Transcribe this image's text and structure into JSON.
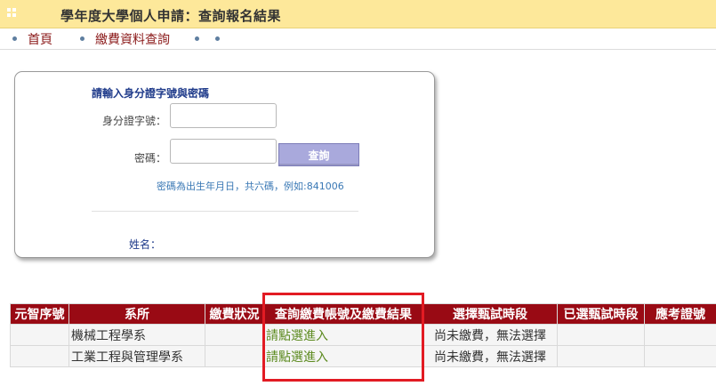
{
  "title": "學年度大學個人申請：查詢報名結果",
  "nav": {
    "home": "首頁",
    "fee_query": "繳費資料查詢"
  },
  "login": {
    "heading": "請輸入身分證字號與密碼",
    "id_label": "身分證字號：",
    "id_value": "",
    "password_label": "密碼：",
    "password_value": "",
    "query_button": "查詢",
    "hint": "密碼為出生年月日，共六碼，例如:841006",
    "name_label": "姓名："
  },
  "table": {
    "headers": [
      "元智序號",
      "系所",
      "繳費狀況",
      "查詢繳費帳號及繳費結果",
      "選擇甄試時段",
      "已選甄試時段",
      "應考證號"
    ],
    "rows": [
      [
        "",
        "機械工程學系",
        "",
        "請點選進入",
        "尚未繳費，無法選擇",
        "",
        ""
      ],
      [
        "",
        "工業工程與管理學系",
        "",
        "請點選進入",
        "尚未繳費，無法選擇",
        "",
        ""
      ]
    ]
  },
  "colors": {
    "title_bar": "#fde89a",
    "table_header": "#990a14",
    "link_green": "#5c8a1f",
    "highlight": "#e21b23"
  }
}
